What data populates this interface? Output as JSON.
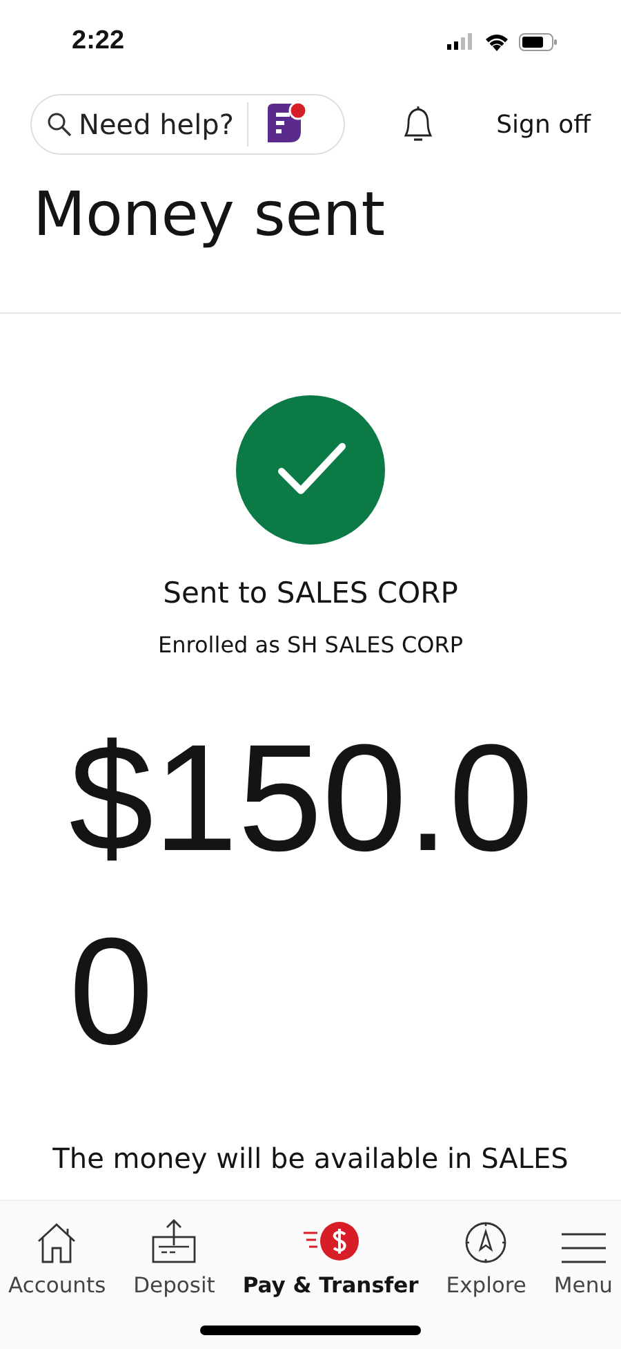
{
  "status_bar": {
    "time": "2:22"
  },
  "header": {
    "search": {
      "placeholder": "Need help?"
    },
    "sign_off": "Sign off"
  },
  "title": "Money sent",
  "confirmation": {
    "recipient": "Sent to SALES CORP",
    "enrolled": "Enrolled as SH SALES CORP",
    "amount": "$150.00",
    "message": "The money will be available in SALES"
  },
  "nav": [
    {
      "kind": "home",
      "label": "Accounts",
      "selected": false
    },
    {
      "kind": "deposit",
      "label": "Deposit",
      "selected": false
    },
    {
      "kind": "pay",
      "label": "Pay & Transfer",
      "selected": true
    },
    {
      "kind": "explore",
      "label": "Explore",
      "selected": false
    },
    {
      "kind": "menu",
      "label": "Menu",
      "selected": false
    }
  ]
}
